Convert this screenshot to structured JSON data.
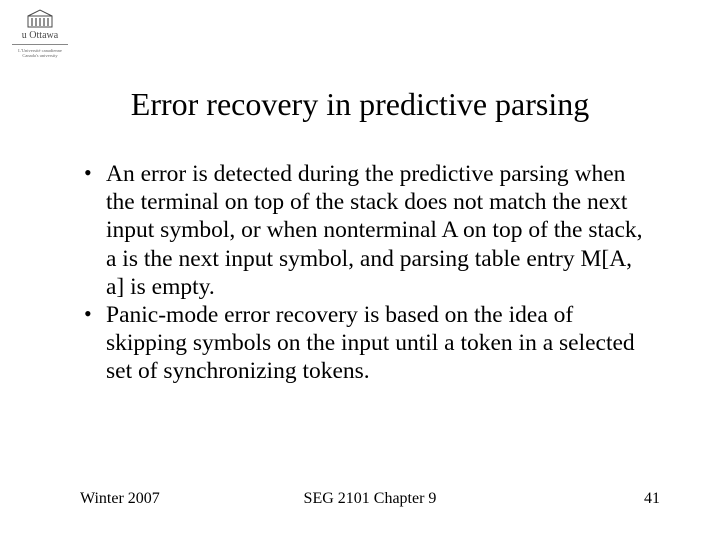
{
  "logo": {
    "name": "u Ottawa",
    "subtitle_line1": "L'Université canadienne",
    "subtitle_line2": "Canada's university"
  },
  "title": "Error recovery in predictive parsing",
  "bullets": [
    "An error is detected during the predictive parsing when the terminal on top of the stack does not match the next input symbol, or when nonterminal A on top of the stack, a is the next input symbol, and parsing table entry M[A, a] is empty.",
    "Panic-mode error recovery is based on the idea of skipping symbols on the input until a token in a selected set of synchronizing tokens."
  ],
  "footer": {
    "left": "Winter 2007",
    "center": "SEG 2101 Chapter 9",
    "right": "41"
  }
}
